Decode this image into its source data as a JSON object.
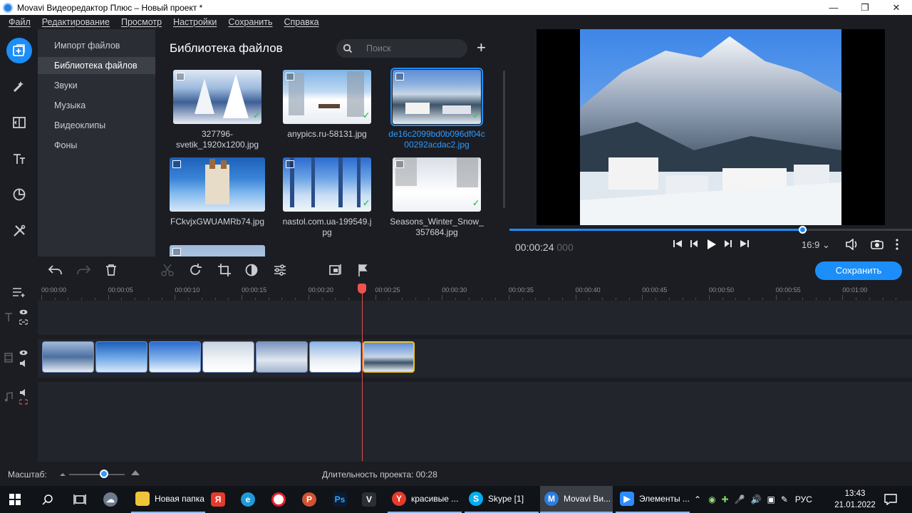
{
  "window": {
    "title": "Movavi Видеоредактор Плюс – Новый проект *"
  },
  "menu": [
    "Файл",
    "Редактирование",
    "Просмотр",
    "Настройки",
    "Сохранить",
    "Справка"
  ],
  "sidebar": {
    "items": [
      {
        "label": "Импорт файлов"
      },
      {
        "label": "Библиотека файлов",
        "active": true
      },
      {
        "label": "Звуки"
      },
      {
        "label": "Музыка"
      },
      {
        "label": "Видеоклипы"
      },
      {
        "label": "Фоны"
      }
    ]
  },
  "library": {
    "title": "Библиотека файлов",
    "search_placeholder": "Поиск",
    "files": [
      {
        "name": "327796-svetik_1920x1200.jpg",
        "line1": "327796-",
        "line2": "svetik_1920x1200.jpg",
        "added": true
      },
      {
        "name": "anypics.ru-58131.jpg",
        "line1": "anypics.ru-58131.jpg",
        "line2": "",
        "added": true
      },
      {
        "name": "de16c2099bd0b096df04c00292acdac2.jpg",
        "line1": "de16c2099bd0b096df04c",
        "line2": "00292acdac2.jpg",
        "added": true,
        "selected": true
      },
      {
        "name": "FCkvjxGWUAMRb74.jpg",
        "line1": "FCkvjxGWUAMRb74.jpg",
        "line2": "",
        "added": false
      },
      {
        "name": "nastol.com.ua-199549.jpg",
        "line1": "nastol.com.ua-199549.j",
        "line2": "pg",
        "added": true
      },
      {
        "name": "Seasons_Winter_Snow_357684.jpg",
        "line1": "Seasons_Winter_Snow_",
        "line2": "357684.jpg",
        "added": true
      }
    ]
  },
  "player": {
    "timecode": "00:00:24",
    "timecode_ms": "000",
    "progress": 0.857,
    "aspect_ratio": "16:9"
  },
  "toolbar": {
    "save_label": "Сохранить"
  },
  "timeline": {
    "ticks": [
      "00:00:00",
      "00:00:05",
      "00:00:10",
      "00:00:15",
      "00:00:20",
      "00:00:25",
      "00:00:30",
      "00:00:35",
      "00:00:40",
      "00:00:45",
      "00:00:50",
      "00:00:55",
      "00:01:00"
    ],
    "clips": 7,
    "selected_clip": 7
  },
  "footer": {
    "scale_label": "Масштаб:",
    "duration_label": "Длительность проекта:",
    "duration_value": "00:28"
  },
  "taskbar": {
    "apps": [
      {
        "label": "Новая папка"
      },
      {
        "label": "красивые ..."
      },
      {
        "label": "Skype [1]"
      },
      {
        "label": "Movavi Ви..."
      },
      {
        "label": "Элементы ..."
      }
    ],
    "language": "РУС",
    "time": "13:43",
    "date": "21.01.2022"
  },
  "colors": {
    "accent": "#1c8ef9",
    "background": "#1b1d22",
    "panel": "#2a2d33",
    "selected_clip": "#f5c518",
    "playhead": "#ef5350"
  }
}
